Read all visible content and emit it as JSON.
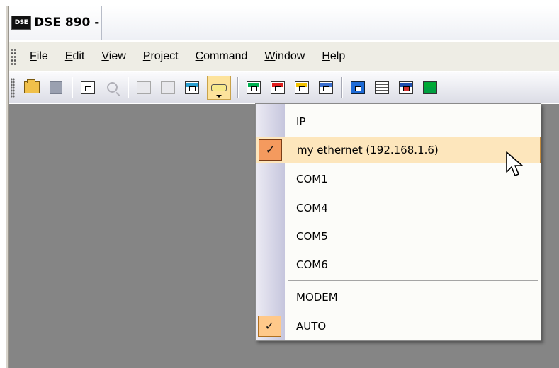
{
  "app": {
    "icon_text": "DSE",
    "title": "DSE 890 -"
  },
  "menubar": {
    "items": [
      {
        "label": "File",
        "accel": "F",
        "rest": "ile"
      },
      {
        "label": "Edit",
        "accel": "E",
        "rest": "dit"
      },
      {
        "label": "View",
        "accel": "V",
        "rest": "iew"
      },
      {
        "label": "Project",
        "accel": "P",
        "rest": "roject"
      },
      {
        "label": "Command",
        "accel": "C",
        "rest": "ommand"
      },
      {
        "label": "Window",
        "accel": "W",
        "rest": "indow"
      },
      {
        "label": "Help",
        "accel": "H",
        "rest": "elp"
      }
    ]
  },
  "toolbar": {
    "icons": [
      {
        "name": "open-folder-icon"
      },
      {
        "name": "save-disk-icon",
        "disabled": true
      },
      {
        "name": "module-view-icon"
      },
      {
        "name": "search-icon",
        "disabled": true
      },
      {
        "name": "disabled-upload-icon",
        "disabled": true
      },
      {
        "name": "disabled-download-icon",
        "disabled": true
      },
      {
        "name": "monitor-icon"
      },
      {
        "name": "serial-port-icon",
        "active": true
      },
      {
        "name": "green-module-icon",
        "color": "#00b050"
      },
      {
        "name": "red-module-icon",
        "color": "#e01e1e"
      },
      {
        "name": "yellow-module-icon",
        "color": "#f2c200"
      },
      {
        "name": "list-module-icon",
        "color": "#3a6fd0"
      },
      {
        "name": "blue-panel-icon",
        "color": "#1e6bd6"
      },
      {
        "name": "table-icon",
        "color": "#555555"
      },
      {
        "name": "chart-window-icon",
        "color": "#d03030"
      },
      {
        "name": "green-window-icon",
        "color": "#00a040"
      }
    ]
  },
  "dropdown": {
    "options": [
      {
        "label": "IP",
        "checked": false,
        "highlighted": false
      },
      {
        "label": "my ethernet  (192.168.1.6)",
        "checked": true,
        "highlighted": true
      },
      {
        "label": "COM1",
        "checked": false,
        "highlighted": false
      },
      {
        "label": "COM4",
        "checked": false,
        "highlighted": false
      },
      {
        "label": "COM5",
        "checked": false,
        "highlighted": false
      },
      {
        "label": "COM6",
        "checked": false,
        "highlighted": false
      },
      {
        "label": "MODEM",
        "checked": false,
        "highlighted": false
      },
      {
        "label": "AUTO",
        "checked": true,
        "highlighted": false
      }
    ],
    "check_glyph": "✓"
  },
  "colors": {
    "workspace": "#858585",
    "highlight": "#fde6bc",
    "check_bg": "#f49a5e"
  }
}
